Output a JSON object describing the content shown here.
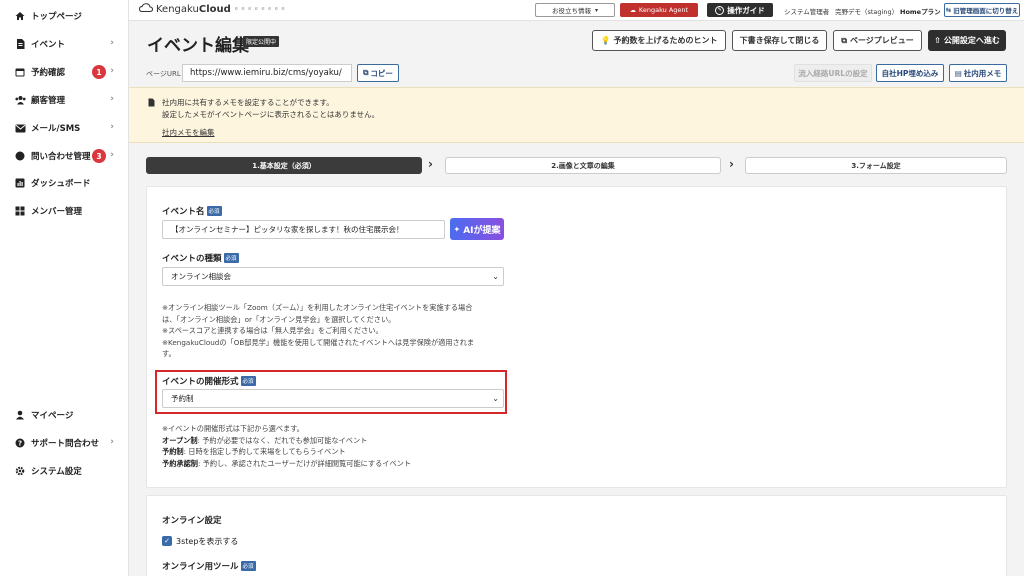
{
  "sidebar": {
    "items": [
      {
        "label": "トップページ",
        "icon": "home-icon"
      },
      {
        "label": "イベント",
        "icon": "document-icon"
      },
      {
        "label": "予約確認",
        "icon": "calendar-icon",
        "badge": "1"
      },
      {
        "label": "顧客管理",
        "icon": "users-icon"
      },
      {
        "label": "メール/SMS",
        "icon": "mail-icon"
      },
      {
        "label": "問い合わせ管理",
        "icon": "chat-icon",
        "badge": "3"
      },
      {
        "label": "ダッシュボード",
        "icon": "chart-icon"
      },
      {
        "label": "メンバー管理",
        "icon": "grid-icon"
      }
    ],
    "bottom_items": [
      {
        "label": "マイページ",
        "icon": "person-icon"
      },
      {
        "label": "サポート問合わせ",
        "icon": "help-icon"
      },
      {
        "label": "システム設定",
        "icon": "gear-icon"
      }
    ]
  },
  "topbar": {
    "logo_main": "Kengaku",
    "logo_bold": "Cloud",
    "logo_sub": "e e e e e e e e",
    "useful_info": "お役立ち情報",
    "agent": "Kengaku Agent",
    "guide": "操作ガイド",
    "role": "システム管理者",
    "user": "完野デモ（staging）",
    "plan": "Homeプラン",
    "switch": "旧管理画面に切り替え"
  },
  "header": {
    "title": "イベント編集",
    "tag": "限定公開中",
    "hint_btn": "予約数を上げるためのヒント",
    "save_btn": "下書き保存して閉じる",
    "preview_btn": "ページプレビュー",
    "publish_btn": "公開設定へ進む"
  },
  "url_row": {
    "label": "ページURL",
    "url": "https://www.iemiru.biz/cms/yoyaku/",
    "copy": "コピー",
    "inflow": "流入経路URLの設定",
    "embed": "自社HP埋め込み",
    "memo": "社内用メモ"
  },
  "memo": {
    "line1": "社内用に共有するメモを設定することができます。",
    "line2": "設定したメモがイベントページに表示されることはありません。",
    "link": "社内メモを編集"
  },
  "steps": [
    "1.基本設定（必須）",
    "2.画像と文章の編集",
    "3.フォーム設定"
  ],
  "form": {
    "required": "必須",
    "event_name_label": "イベント名",
    "event_name_value": "【オンラインセミナー】ピッタリな家を探します！秋の住宅展示会！",
    "ai_btn": "AIが提案",
    "event_type_label": "イベントの種類",
    "event_type_value": "オンライン相談会",
    "type_notes": [
      "※オンライン相談ツール「Zoom（ズーム）」を利用したオンライン住宅イベントを実施する場合",
      "は、「オンライン相談会」or「オンライン見学会」を選択してください。",
      "※スペースコアと連携する場合は「無人見学会」をご利用ください。",
      "※KengakuCloudの「OB邸見学」機能を使用して開催されたイベントへは見学保険が適用されま",
      "す。"
    ],
    "format_label": "イベントの開催形式",
    "format_value": "予約制",
    "format_note_intro": "※イベントの開催形式は下記から選べます。",
    "format_options": [
      {
        "name": "オープン制",
        "desc": ": 予約が必要ではなく、だれでも参加可能なイベント"
      },
      {
        "name": "予約制",
        "desc": ": 日時を指定し予約して来場をしてもらうイベント"
      },
      {
        "name": "予約承認制",
        "desc": ": 予約し、承認されたユーザーだけが詳細閲覧可能にするイベント"
      }
    ]
  },
  "online": {
    "title": "オンライン設定",
    "checkbox": "3stepを表示する",
    "tool_label": "オンライン用ツール"
  }
}
